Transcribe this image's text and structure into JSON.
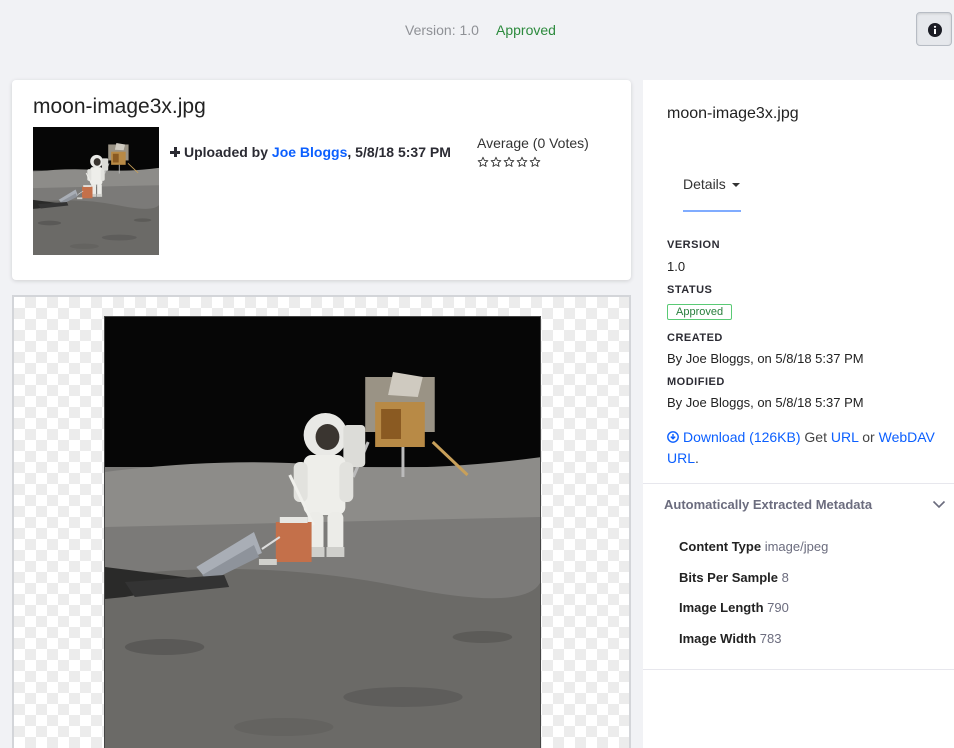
{
  "topbar": {
    "version_text": "Version: 1.0",
    "status_text": "Approved",
    "info_icon": "info-circle-icon"
  },
  "header": {
    "title": "moon-image3x.jpg",
    "uploaded_prefix": "Uploaded by",
    "uploader": "Joe Bloggs",
    "uploaded_date": ", 5/8/18 5:37 PM",
    "rating_text": "Average (0 Votes)",
    "rating_value": 0,
    "rating_max": 5
  },
  "sidebar": {
    "title": "moon-image3x.jpg",
    "tab_label": "Details",
    "version_label": "VERSION",
    "version_value": "1.0",
    "status_label": "STATUS",
    "status_badge": "Approved",
    "created_label": "CREATED",
    "created_value": "By Joe Bloggs, on 5/8/18 5:37 PM",
    "modified_label": "MODIFIED",
    "modified_value": "By Joe Bloggs, on 5/8/18 5:37 PM",
    "download_label": "Download (126KB)",
    "get_text": "Get",
    "url_label": "URL",
    "or_text": "or",
    "webdav_label": "WebDAV",
    "webdav_url_label": "URL",
    "period": "."
  },
  "metadata": {
    "heading": "Automatically Extracted Metadata",
    "rows": [
      {
        "key": "Content Type",
        "value": "image/jpeg"
      },
      {
        "key": "Bits Per Sample",
        "value": "8"
      },
      {
        "key": "Image Length",
        "value": "790"
      },
      {
        "key": "Image Width",
        "value": "783"
      }
    ]
  },
  "colors": {
    "accent": "#0b5fff",
    "approved": "#2c8a3d",
    "background": "#f1f2f5"
  }
}
